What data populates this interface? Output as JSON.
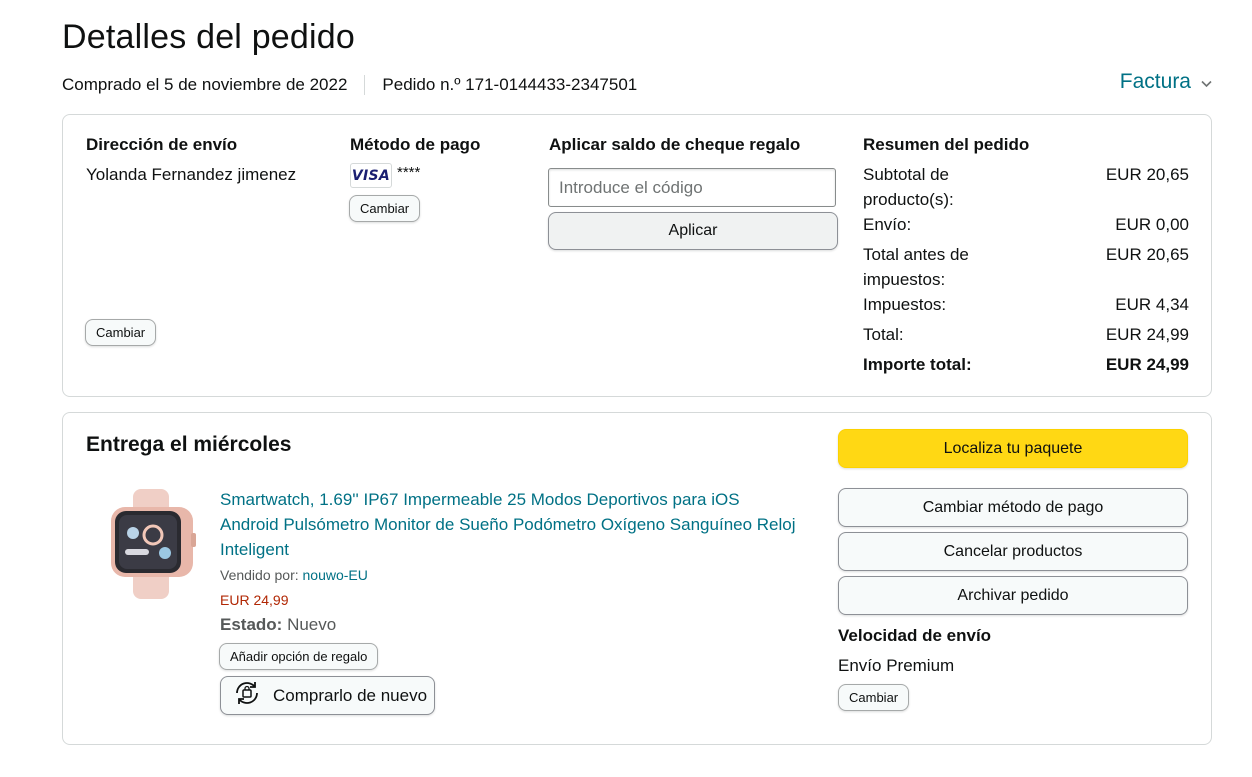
{
  "header": {
    "title": "Detalles del pedido",
    "purchase_date": "Comprado el 5 de noviembre de 2022",
    "order_number": "Pedido n.º 171-0144433-2347501",
    "invoice_label": "Factura"
  },
  "shipping": {
    "title": "Dirección de envío",
    "name": "Yolanda Fernandez jimenez",
    "change_label": "Cambiar"
  },
  "payment": {
    "title": "Método de pago",
    "card_brand": "VISA",
    "card_masked": "****",
    "change_label": "Cambiar"
  },
  "gift_card": {
    "title": "Aplicar saldo de cheque regalo",
    "placeholder": "Introduce el código",
    "apply_label": "Aplicar"
  },
  "summary": {
    "title": "Resumen del pedido",
    "rows": [
      {
        "label": "Subtotal de producto(s):",
        "value": "EUR 20,65"
      },
      {
        "label": "Envío:",
        "value": "EUR 0,00"
      },
      {
        "label": "Total antes de impuestos:",
        "value": "EUR 20,65"
      },
      {
        "label": "Impuestos:",
        "value": "EUR 4,34"
      },
      {
        "label": "Total:",
        "value": "EUR 24,99"
      },
      {
        "label": "Importe total:",
        "value": "EUR 24,99"
      }
    ]
  },
  "delivery": {
    "title": "Entrega el miércoles",
    "product": {
      "title": "Smartwatch, 1.69'' IP67 Impermeable 25 Modos Deportivos para iOS Android Pulsómetro Monitor de Sueño Podómetro Oxígeno Sanguíneo Reloj Inteligent",
      "seller_prefix": "Vendido por:",
      "seller_name": "nouwo-EU",
      "price": "EUR 24,99",
      "condition_label": "Estado:",
      "condition_value": "Nuevo",
      "gift_option_label": "Añadir opción de regalo",
      "buy_again_label": "Comprarlo de nuevo"
    },
    "actions": {
      "track_label": "Localiza tu paquete",
      "change_payment_label": "Cambiar método de pago",
      "cancel_label": "Cancelar productos",
      "archive_label": "Archivar pedido"
    },
    "shipping_speed": {
      "title": "Velocidad de envío",
      "value": "Envío Premium",
      "change_label": "Cambiar"
    }
  },
  "colors": {
    "link": "#007185",
    "price": "#b12704",
    "primary_button": "#ffd814",
    "border": "#d5d9d9"
  }
}
